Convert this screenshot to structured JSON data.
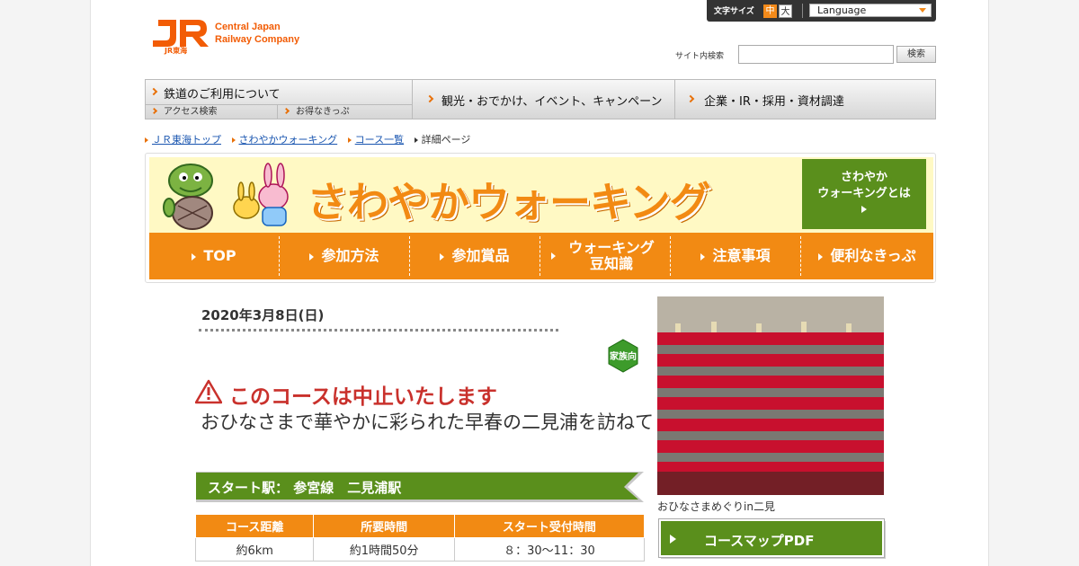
{
  "header": {
    "logo_mark": "JR東海",
    "company_line1": "Central Japan",
    "company_line2": "Railway Company",
    "font_size_label": "文字サイズ",
    "font_size_mid": "中",
    "font_size_large": "大",
    "language_label": "Language",
    "search_label": "サイト内検索",
    "search_value": "",
    "search_button": "検索"
  },
  "global_nav": {
    "rail": "鉄道のご利用について",
    "access": "アクセス検索",
    "deals": "お得なきっぷ",
    "tourism": "観光・おでかけ、イベント、キャンペーン",
    "corporate": "企業・IR・採用・資材調達"
  },
  "breadcrumb": [
    "ＪＲ東海トップ",
    "さわやかウォーキング",
    "コース一覧",
    "詳細ページ"
  ],
  "banner": {
    "title": "さわやかウォーキング",
    "about_line1": "さわやか",
    "about_line2": "ウォーキングとは"
  },
  "tabs": [
    {
      "line1": "TOP",
      "line2": ""
    },
    {
      "line1": "参加方法",
      "line2": ""
    },
    {
      "line1": "参加賞品",
      "line2": ""
    },
    {
      "line1": "ウォーキング",
      "line2": "豆知識"
    },
    {
      "line1": "注意事項",
      "line2": ""
    },
    {
      "line1": "便利なきっぷ",
      "line2": ""
    }
  ],
  "course": {
    "date": "2020年3月8日(日)",
    "badge": "家族向",
    "cancel_notice": "このコースは中止いたします",
    "title": "おひなさまで華やかに彩られた早春の二見浦を訪ねて",
    "start_station": "スタート駅：  参宮線　二見浦駅",
    "table_headers": [
      "コース距離",
      "所要時間",
      "スタート受付時間"
    ],
    "table_values": [
      "約6km",
      "約1時間50分",
      "８：30～11：30"
    ],
    "photo_caption": "おひなさまめぐりin二見",
    "pdf_button": "コースマップPDF"
  },
  "colors": {
    "brand_orange": "#f28a13",
    "jr_orange": "#f25c05",
    "green": "#5a8f1c",
    "alert_red": "#c9312c"
  }
}
